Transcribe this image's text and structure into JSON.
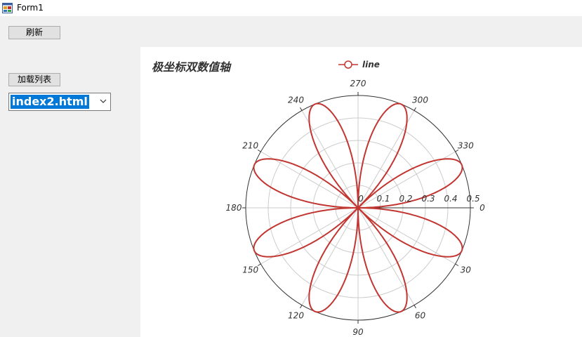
{
  "window": {
    "title": "Form1",
    "icon": "windows-form-icon"
  },
  "toolbar": {
    "refresh_label": "刷新"
  },
  "sidebar": {
    "load_list_label": "加载列表",
    "dropdown_value": "index2.html",
    "dropdown_icon": "chevron-down-icon"
  },
  "colors": {
    "series": "#c23531",
    "selection": "#0078d7"
  },
  "chart_data": {
    "type": "line",
    "coordinate_system": "polar",
    "title": "极坐标双数值轴",
    "legend": [
      "line"
    ],
    "legend_position": "top",
    "angle_axis": {
      "min": 0,
      "max": 360,
      "interval": 30,
      "start_angle": 0,
      "clockwise": true,
      "tick_labels": [
        "0",
        "30",
        "60",
        "90",
        "120",
        "150",
        "180",
        "210",
        "240",
        "270",
        "300",
        "330"
      ]
    },
    "radius_axis": {
      "min": 0,
      "max": 0.5,
      "interval": 0.1,
      "tick_labels": [
        "0",
        "0.1",
        "0.2",
        "0.3",
        "0.4",
        "0.5"
      ]
    },
    "series": [
      {
        "name": "line",
        "formula": "r = 0.5 * |sin(4θ)|",
        "amplitude": 0.5,
        "petal_frequency": 4,
        "theta_step_deg": 1,
        "theta_range": [
          0,
          360
        ]
      }
    ],
    "grid": true
  }
}
